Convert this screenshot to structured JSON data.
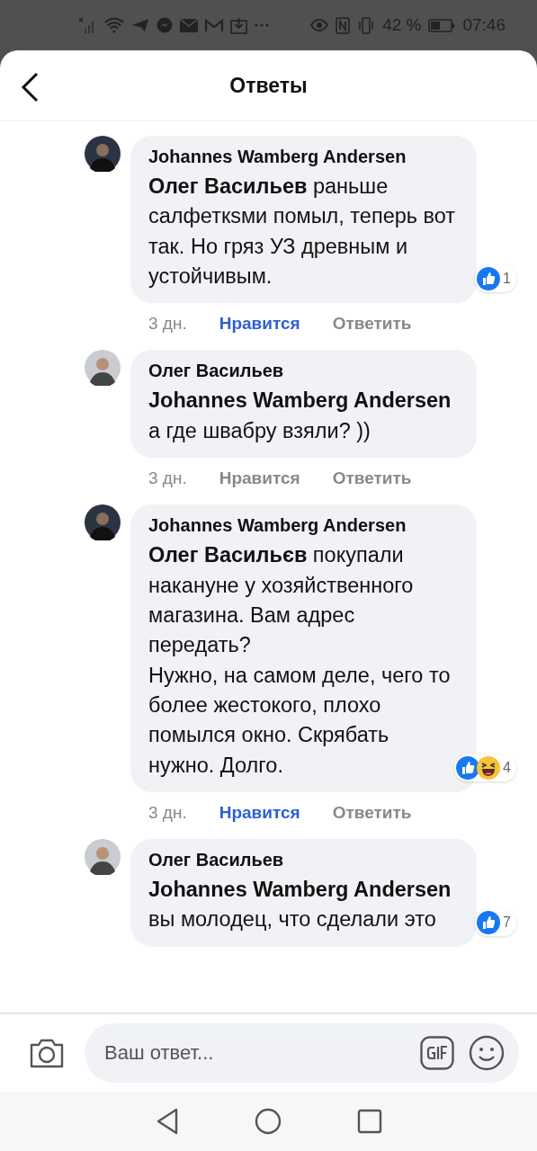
{
  "status_bar": {
    "battery_text": "42 %",
    "time": "07:46"
  },
  "header": {
    "title": "Ответы"
  },
  "comments": [
    {
      "author": "Johannes Wamberg Andersen",
      "text": "**Олег Васильев** раньше салфеткѕми помыл, теперь вот так. Но гряз УЗ древным  и устойчивым.",
      "reactions": [
        {
          "kind": "like"
        }
      ],
      "reaction_count": "1",
      "time": "3 дн.",
      "like_label": "Нравится",
      "liked": true,
      "reply_label": "Ответить"
    },
    {
      "author": "Олег Васильев",
      "text": "**Johannes Wamberg Andersen** а где швабру взяли? ))",
      "time": "3 дн.",
      "like_label": "Нравится",
      "liked": false,
      "reply_label": "Ответить"
    },
    {
      "author": "Johannes Wamberg Andersen",
      "text": "**Олег Васильєв** покупали накануне у хозяйственного магазина. Вам адрес передать?\nНужно, на самом деле, чего то более жестокого, плохо помылся окно. Скрябать нужно. Долго.",
      "reactions": [
        {
          "kind": "like"
        },
        {
          "kind": "haha"
        }
      ],
      "reaction_count": "4",
      "time": "3 дн.",
      "like_label": "Нравится",
      "liked": true,
      "reply_label": "Ответить"
    },
    {
      "author": "Олег Васильев",
      "text": "**Johannes Wamberg Andersen** вы молодец, что сделали это",
      "reactions": [
        {
          "kind": "like"
        }
      ],
      "reaction_count": "7"
    }
  ],
  "composer": {
    "placeholder": "Ваш ответ..."
  }
}
